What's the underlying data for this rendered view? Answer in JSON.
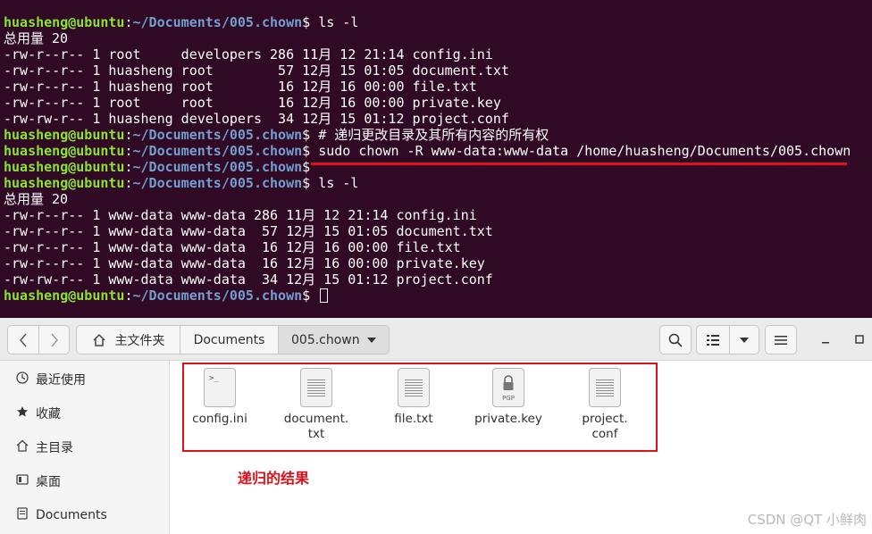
{
  "terminal": {
    "lines": [
      {
        "user": "huasheng@ubuntu",
        "path": "~/Documents/005.chown",
        "cmd": " ls -l"
      },
      {
        "out": "总用量 20"
      },
      {
        "out": "-rw-r--r-- 1 root     developers 286 11月 12 21:14 config.ini"
      },
      {
        "out": "-rw-r--r-- 1 huasheng root        57 12月 15 01:05 document.txt"
      },
      {
        "out": "-rw-r--r-- 1 huasheng root        16 12月 16 00:00 file.txt"
      },
      {
        "out": "-rw-r--r-- 1 root     root        16 12月 16 00:00 private.key"
      },
      {
        "out": "-rw-rw-r-- 1 huasheng developers  34 12月 15 01:12 project.conf"
      },
      {
        "user": "huasheng@ubuntu",
        "path": "~/Documents/005.chown",
        "cmd": " # 递归更改目录及其所有内容的所有权"
      },
      {
        "user": "huasheng@ubuntu",
        "path": "~/Documents/005.chown",
        "cmd": " sudo chown -R www-data:www-data /home/huasheng/Documents/005.chown"
      },
      {
        "user": "huasheng@ubuntu",
        "path": "~/Documents/005.chown",
        "cmd": ""
      },
      {
        "user": "huasheng@ubuntu",
        "path": "~/Documents/005.chown",
        "cmd": " ls -l"
      },
      {
        "out": "总用量 20"
      },
      {
        "out": "-rw-r--r-- 1 www-data www-data 286 11月 12 21:14 config.ini"
      },
      {
        "out": "-rw-r--r-- 1 www-data www-data  57 12月 15 01:05 document.txt"
      },
      {
        "out": "-rw-r--r-- 1 www-data www-data  16 12月 16 00:00 file.txt"
      },
      {
        "out": "-rw-r--r-- 1 www-data www-data  16 12月 16 00:00 private.key"
      },
      {
        "out": "-rw-rw-r-- 1 www-data www-data  34 12月 15 01:12 project.conf"
      },
      {
        "user": "huasheng@ubuntu",
        "path": "~/Documents/005.chown",
        "cmd": " ",
        "cursor": true
      }
    ],
    "prompt_sep": ":",
    "prompt_end": "$",
    "colors": {
      "background": "#300a24",
      "user": "#8ae234",
      "path": "#729fcf",
      "highlight": "#e0101a"
    }
  },
  "filemanager": {
    "breadcrumbs": [
      {
        "label": "主文件夹",
        "icon": "home-icon"
      },
      {
        "label": "Documents"
      },
      {
        "label": "005.chown",
        "active": true
      }
    ],
    "sidebar": [
      {
        "label": "最近使用",
        "icon": "clock-icon"
      },
      {
        "label": "收藏",
        "icon": "star-icon"
      },
      {
        "label": "主目录",
        "icon": "home-icon"
      },
      {
        "label": "桌面",
        "icon": "desktop-icon"
      },
      {
        "label": "Documents",
        "icon": "document-icon"
      }
    ],
    "files": [
      {
        "name": "config.ini",
        "icon": "terminal-file-icon"
      },
      {
        "name": "document.\ntxt",
        "icon": "text-file-icon"
      },
      {
        "name": "file.txt",
        "icon": "text-file-icon"
      },
      {
        "name": "private.key",
        "icon": "pgp-key-icon",
        "badge": "PGP"
      },
      {
        "name": "project.\nconf",
        "icon": "text-file-icon"
      }
    ],
    "annotation": "递归的结果",
    "watermark": "CSDN @QT 小鲜肉"
  }
}
